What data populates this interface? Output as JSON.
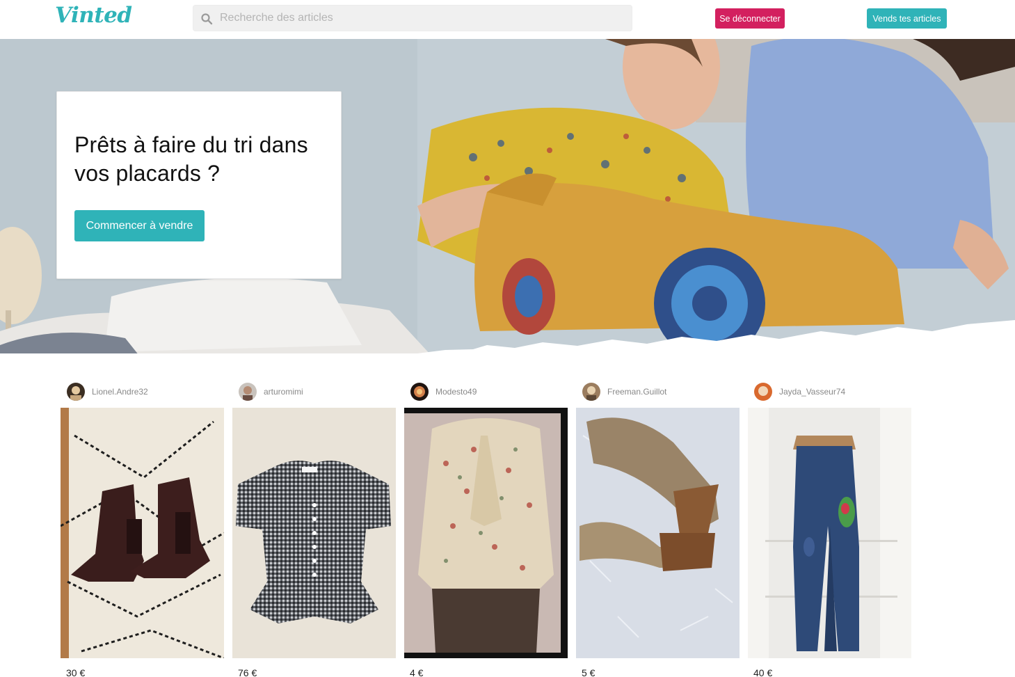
{
  "header": {
    "logo_text": "Vinted",
    "search_placeholder": "Recherche des articles",
    "search_value": "",
    "logout_label": "Se déconnecter",
    "sell_label": "Vends tes articles"
  },
  "hero": {
    "title": "Prêts à faire du tri dans vos placards ?",
    "cta_label": "Commencer à vendre"
  },
  "items": [
    {
      "seller": "Lionel.Andre32",
      "price": "30 €",
      "photo": "brown-leather-ankle-boots"
    },
    {
      "seller": "arturomimi",
      "price": "76 €",
      "photo": "gingham-peplum-blouse"
    },
    {
      "seller": "Modesto49",
      "price": "4 €",
      "photo": "floral-tie-neck-blouse"
    },
    {
      "seller": "Freeman.Guillot",
      "price": "5 €",
      "photo": "wedge-pumps"
    },
    {
      "seller": "Jayda_Vasseur74",
      "price": "40 €",
      "photo": "embroidered-jeans"
    }
  ],
  "colors": {
    "brand": "#2fb3b8",
    "logout": "#d3205f"
  }
}
